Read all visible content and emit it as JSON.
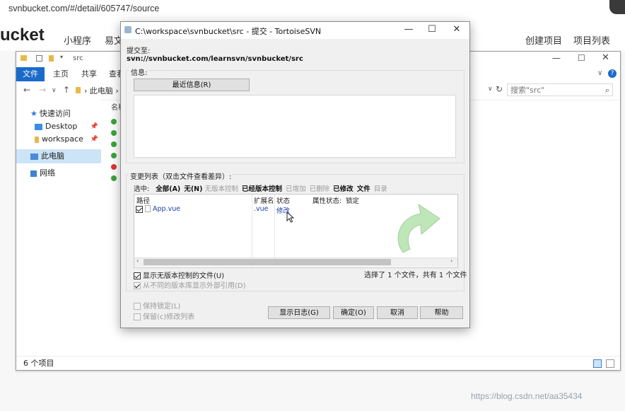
{
  "browser": {
    "url": "svnbucket.com/#/detail/605747/source"
  },
  "site": {
    "logo": "ucket",
    "nav": [
      "小程序",
      "易文"
    ],
    "right_nav": [
      "创建项目",
      "项目列表"
    ]
  },
  "explorer": {
    "path_title": "src",
    "ribbon_tabs": [
      "文件",
      "主页",
      "共享",
      "查看"
    ],
    "address": "此电脑",
    "search_placeholder": "搜索\"src\"",
    "column_name": "名称",
    "nav_items": [
      "快速访问",
      "Desktop",
      "workspace",
      "此电脑",
      "网络"
    ],
    "status": "6 个项目"
  },
  "dialog": {
    "title": "C:\\workspace\\svnbucket\\src - 提交 - TortoiseSVN",
    "commit_to_label": "提交至:",
    "commit_url": "svn://svnbucket.com/learnsvn/svnbucket/src",
    "message_label": "信息:",
    "recent_msg_button": "最近信息(R)",
    "changes_label": "变更列表（双击文件查看差异）:",
    "filter": {
      "select": "选中:",
      "all": "全部(A)",
      "none": "无(N)",
      "unversioned": "无版本控制",
      "versioned": "已经版本控制",
      "added": "已增加",
      "deleted": "已删除",
      "modified": "已修改",
      "files": "文件",
      "dirs": "目录"
    },
    "columns": [
      "路径",
      "扩展名",
      "状态",
      "属性状态:",
      "锁定"
    ],
    "rows": [
      {
        "path": "App.vue",
        "ext": ".vue",
        "status": "修改"
      }
    ],
    "show_unversioned": "显示无版本控制的文件(U)",
    "show_externals": "从不同的版本库显示外部引用(D)",
    "selection_summary": "选择了 1 个文件，共有 1 个文件",
    "keep_locks": "保持锁定(L)",
    "keep_changelists": "保留(c)修改列表",
    "buttons": {
      "show_log": "显示日志(G)",
      "ok": "确定(O)",
      "cancel": "取消",
      "help": "帮助"
    }
  },
  "watermark": "https://blog.csdn.net/aa35434",
  "colors": {
    "accent": "#1b6ac9",
    "link_blue": "#1f3fa8",
    "selection": "#cce4f7"
  }
}
